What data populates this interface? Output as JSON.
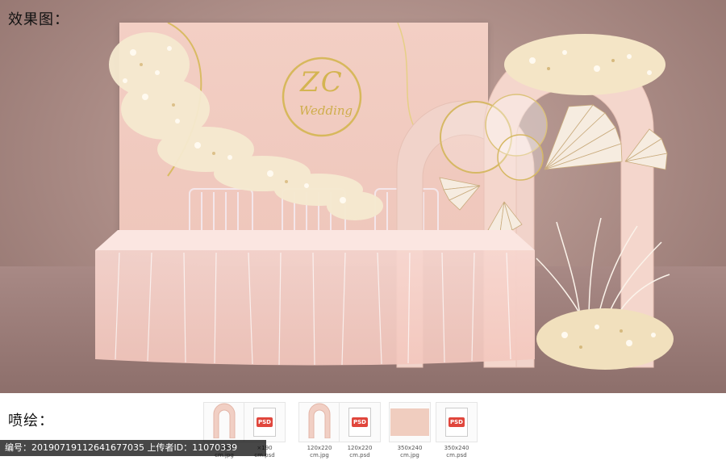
{
  "labels": {
    "effect": "效果图：",
    "print": "喷绘："
  },
  "monogram": {
    "letters": "ZC",
    "script": "Wedding"
  },
  "footer": {
    "text": "编号：20190719112641677035 上传者ID：11070339"
  },
  "thumbnails": [
    {
      "icon": "arch-image-icon",
      "caption": "×190\ncm.jpg"
    },
    {
      "icon": "psd-file-icon",
      "caption": "×190\ncm.psd",
      "badge": "PSD"
    },
    {
      "icon": "arch-image-icon",
      "caption": "120x220\ncm.jpg"
    },
    {
      "icon": "psd-file-icon",
      "caption": "120x220\ncm.psd",
      "badge": "PSD"
    },
    {
      "icon": "backdrop-image-icon",
      "caption": "350x240\ncm.jpg"
    },
    {
      "icon": "psd-file-icon",
      "caption": "350x240\ncm.psd",
      "badge": "PSD"
    }
  ],
  "colors": {
    "backdrop": "#f1cbc0",
    "gold": "#d8b85a",
    "floor": "#9a7b77",
    "flowers": "#f3e6c8"
  }
}
